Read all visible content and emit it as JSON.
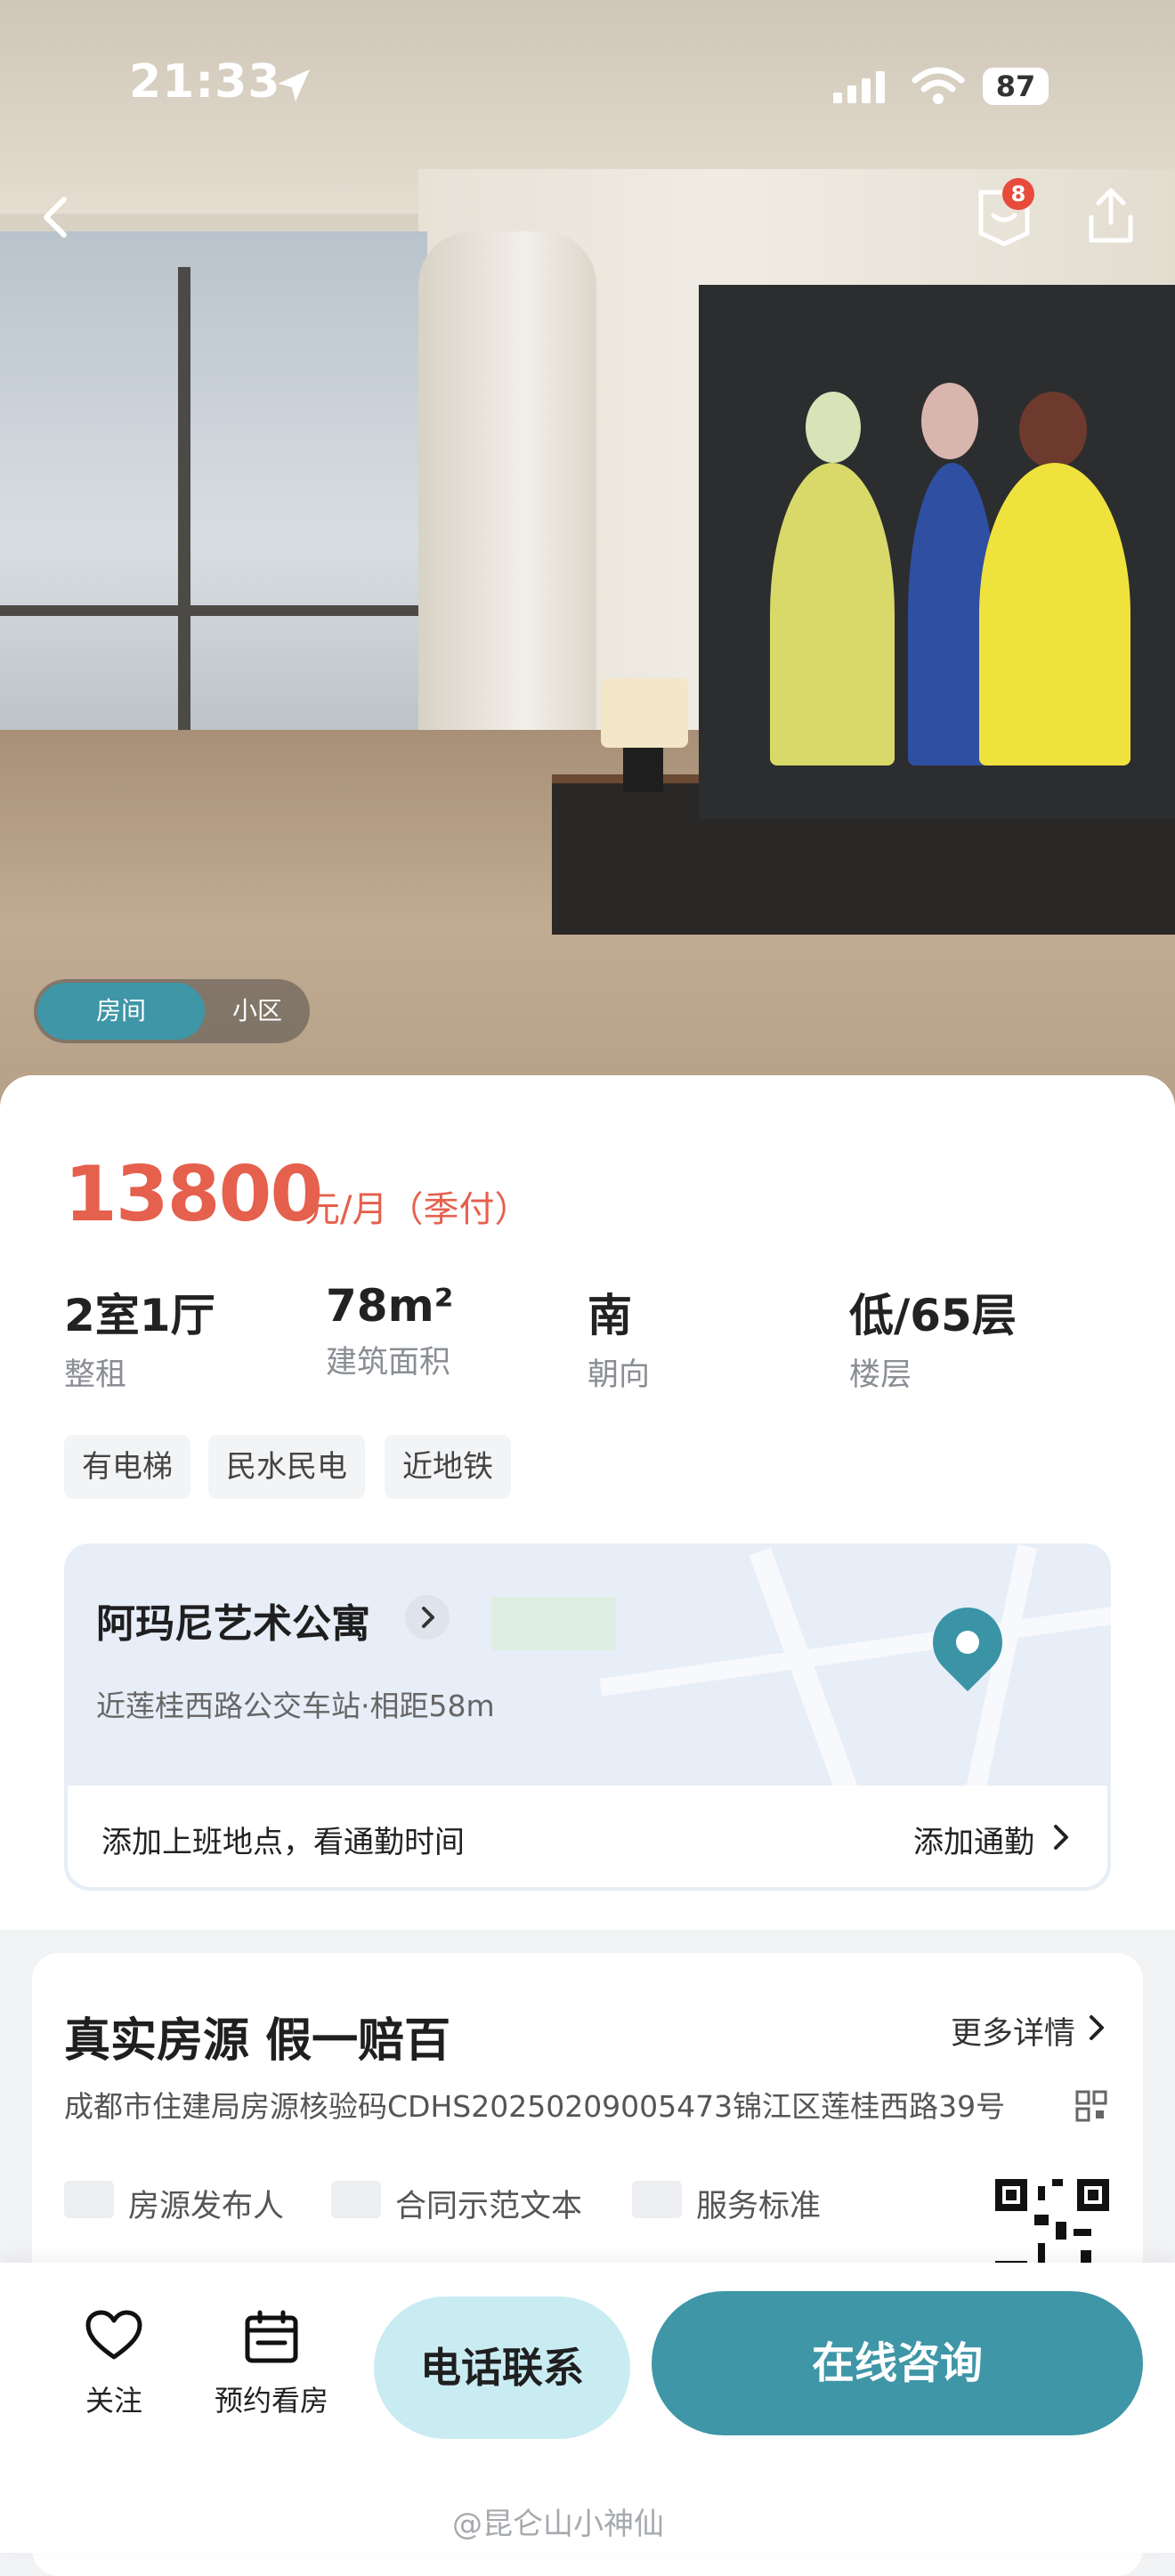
{
  "status_bar": {
    "time": "21:33",
    "battery": "87"
  },
  "nav": {
    "notification_count": "8"
  },
  "photo_toggle": {
    "room": "房间",
    "community": "小区"
  },
  "listing": {
    "price": "13800",
    "price_unit": "元/月（季付）",
    "specs": [
      {
        "value": "2室1厅",
        "label": "整租"
      },
      {
        "value": "78m²",
        "label": "建筑面积"
      },
      {
        "value": "南",
        "label": "朝向"
      },
      {
        "value": "低/65层",
        "label": "楼层"
      }
    ],
    "tags": [
      "有电梯",
      "民水民电",
      "近地铁"
    ]
  },
  "location": {
    "name": "阿玛尼艺术公寓",
    "nearby": "近莲桂西路公交车站·相距58m",
    "commute_prompt": "添加上班地点，看通勤时间",
    "commute_action": "添加通勤"
  },
  "guarantee": {
    "title": "真实房源 假一赔百",
    "more": "更多详情",
    "verify_text": "成都市住建局房源核验码CDHS20250209005473锦江区莲桂西路39号",
    "items": [
      "房源发布人",
      "合同示范文本",
      "服务标准"
    ]
  },
  "bottom_bar": {
    "follow": "关注",
    "viewing": "预约看房",
    "call": "电话联系",
    "consult": "在线咨询"
  },
  "watermark": "@昆仑山小神仙",
  "colors": {
    "accent": "#3e96a7",
    "price": "#e5604d",
    "call_bg": "#c9ecf2"
  }
}
